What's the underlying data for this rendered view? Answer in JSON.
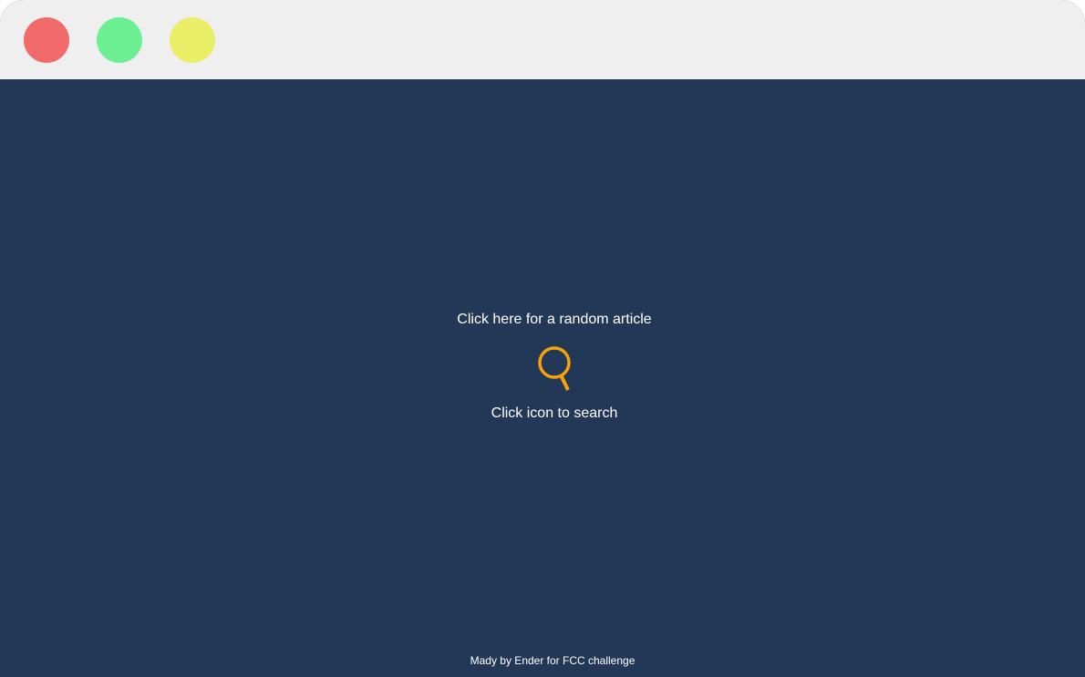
{
  "window": {
    "controls": [
      {
        "name": "close",
        "color": "#f16b6b"
      },
      {
        "name": "maximize",
        "color": "#6bef92"
      },
      {
        "name": "minimize",
        "color": "#eaed66"
      }
    ],
    "background": "#233757",
    "titlebar_color": "#efefef"
  },
  "main": {
    "random_link": "Click here for a random article",
    "search_icon": {
      "name": "magnifier-icon",
      "color": "#f5a20b"
    },
    "search_hint": "Click icon to search"
  },
  "footer": {
    "text": "Mady by Ender for FCC challenge"
  }
}
